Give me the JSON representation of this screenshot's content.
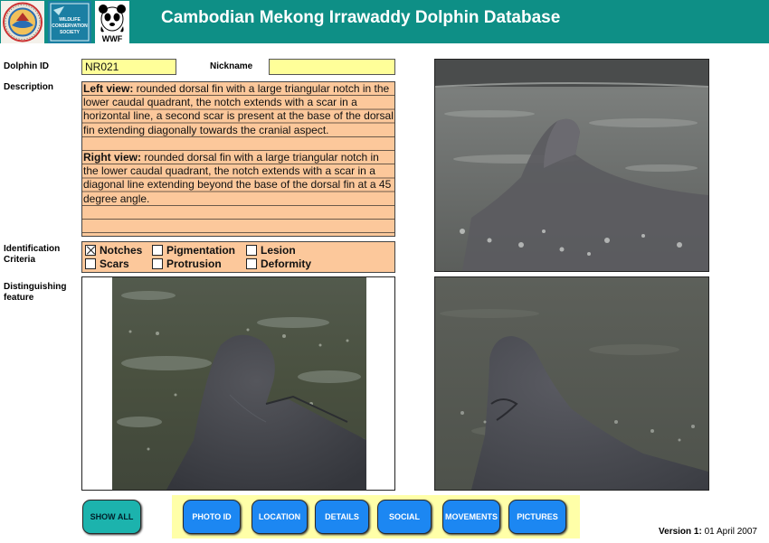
{
  "header": {
    "title": "Cambodian Mekong Irrawaddy Dolphin Database",
    "logos": [
      "fisheries-administration-logo",
      "wildlife-conservation-society-logo",
      "wwf-panda-logo"
    ],
    "logo2_text": [
      "WILDLIFE",
      "CONSERVATION",
      "SOCIETY"
    ],
    "logo3_text": "WWF",
    "color": "#0e8f86"
  },
  "form": {
    "dolphin_id_label": "Dolphin ID",
    "dolphin_id_value": "NR021",
    "nickname_label": "Nickname",
    "nickname_value": "",
    "description_label": "Description",
    "description": {
      "left_heading": "Left view:",
      "left_text": " rounded dorsal fin with a large triangular notch in the lower caudal quadrant, the notch extends with a scar in a horizontal line, a second scar is present at the base of the dorsal fin extending diagonally towards the cranial aspect.",
      "right_heading": "Right view:",
      "right_text": " rounded dorsal fin with a large triangular notch in the lower caudal quadrant, the notch extends with a scar in a diagonal line extending beyond the base of the dorsal fin at a 45 degree angle."
    },
    "criteria_label_1": "Identification",
    "criteria_label_2": "Criteria",
    "criteria": [
      {
        "label": "Notches",
        "checked": true
      },
      {
        "label": "Pigmentation",
        "checked": false
      },
      {
        "label": "Lesion",
        "checked": false
      },
      {
        "label": "Scars",
        "checked": false
      },
      {
        "label": "Protrusion",
        "checked": false
      },
      {
        "label": "Deformity",
        "checked": false
      }
    ],
    "distinguishing_label_1": "Distinguishing",
    "distinguishing_label_2": "feature",
    "field_color": "#ffff99",
    "panel_color": "#fcc89b"
  },
  "buttons": {
    "show_all": "SHOW ALL",
    "photo_id": "PHOTO ID",
    "location": "LOCATION",
    "details": "DETAILS",
    "social": "SOCIAL",
    "movements": "MOVEMENTS",
    "pictures": "PICTURES"
  },
  "footer": {
    "version_label": "Version 1:",
    "version_date": " 01 April 2007"
  }
}
